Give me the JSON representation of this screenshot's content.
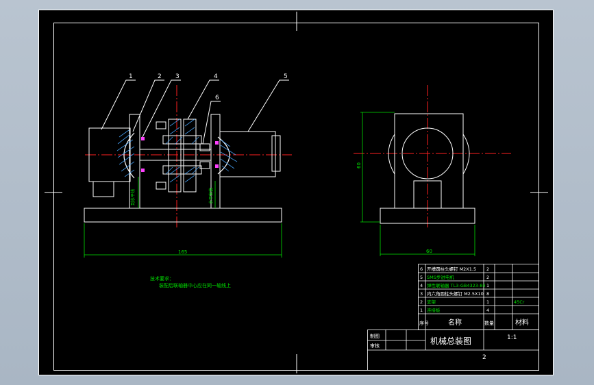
{
  "colors": {
    "background": "#000000",
    "frame": "#ffffff",
    "centerline": "#ff2020",
    "dimension": "#00e000",
    "part": "#ffffff",
    "hatch": "#4aa8ff",
    "highlight": "#ff40ff",
    "note_text": "#00e000",
    "table_text": "#ffffff"
  },
  "balloons": [
    "1",
    "2",
    "3",
    "4",
    "5",
    "6"
  ],
  "dimensions": {
    "front_width": "165",
    "side_width": "60",
    "side_height": "60",
    "vertical_label_a": "到水平线",
    "vertical_label_b": "水平安装"
  },
  "notes": {
    "heading": "技术要求：",
    "line1": "装配后联轴器中心应在同一轴线上"
  },
  "parts_list": {
    "header": {
      "no": "序号",
      "name": "名称",
      "qty": "数量",
      "material": "材料"
    },
    "rows": [
      {
        "no": "6",
        "name": "开槽圆柱头螺钉 M2X1.5",
        "qty": "2",
        "material": ""
      },
      {
        "no": "5",
        "name": "SMS步进电机",
        "qty": "2",
        "material": ""
      },
      {
        "no": "4",
        "name": "弹性联轴器 TL3-GB4323-84",
        "qty": "1",
        "material": ""
      },
      {
        "no": "3",
        "name": "内六角圆柱头螺钉 M2.5X10",
        "qty": "8",
        "material": ""
      },
      {
        "no": "2",
        "name": "支架",
        "qty": "1",
        "material": "45Cr"
      },
      {
        "no": "1",
        "name": "连接板",
        "qty": "4",
        "material": ""
      }
    ]
  },
  "title_block": {
    "drawn_label": "制图",
    "checked_label": "审核",
    "title": "机械总装图",
    "scale": "1:1",
    "sheet": "2"
  }
}
